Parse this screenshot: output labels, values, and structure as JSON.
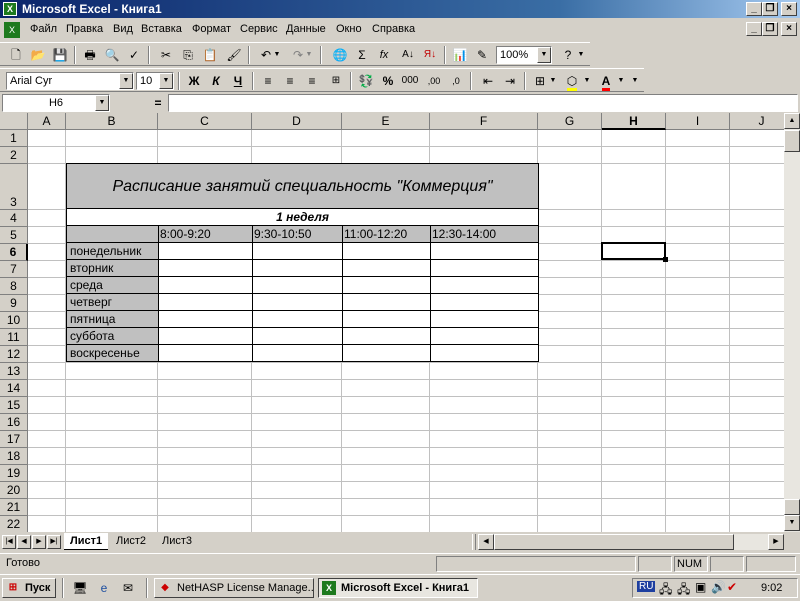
{
  "window": {
    "title": "Microsoft Excel - Книга1"
  },
  "menu": [
    "Файл",
    "Правка",
    "Вид",
    "Вставка",
    "Формат",
    "Сервис",
    "Данные",
    "Окно",
    "Справка"
  ],
  "toolbar": {
    "zoom": "100%",
    "font": "Arial Cyr",
    "size": "10",
    "bold": "Ж",
    "italic": "К",
    "underline": "Ч",
    "percent": "%",
    "thousands": "000",
    "fx": "fx",
    "sigma": "Σ"
  },
  "formula": {
    "name_box": "H6",
    "equals": "="
  },
  "columns": [
    "A",
    "B",
    "C",
    "D",
    "E",
    "F",
    "G",
    "H",
    "I",
    "J"
  ],
  "rows": [
    "1",
    "2",
    "3",
    "4",
    "5",
    "6",
    "7",
    "8",
    "9",
    "10",
    "11",
    "12",
    "13",
    "14",
    "15",
    "16",
    "17",
    "18",
    "19",
    "20",
    "21",
    "22"
  ],
  "sheet": {
    "title": "Расписание занятий специальность \"Коммерция\"",
    "week": "1 неделя",
    "times": [
      "8:00-9:20",
      "9:30-10:50",
      "11:00-12:20",
      "12:30-14:00"
    ],
    "days": [
      "понедельник",
      "вторник",
      "среда",
      "четверг",
      "пятница",
      "суббота",
      "воскресенье"
    ]
  },
  "sheet_tabs": [
    "Лист1",
    "Лист2",
    "Лист3"
  ],
  "status": {
    "ready": "Готово",
    "num": "NUM"
  },
  "taskbar": {
    "start": "Пуск",
    "tasks": [
      "NetHASP License Manage...",
      "Microsoft Excel - Книга1"
    ],
    "lang": "RU",
    "clock": "9:02"
  }
}
